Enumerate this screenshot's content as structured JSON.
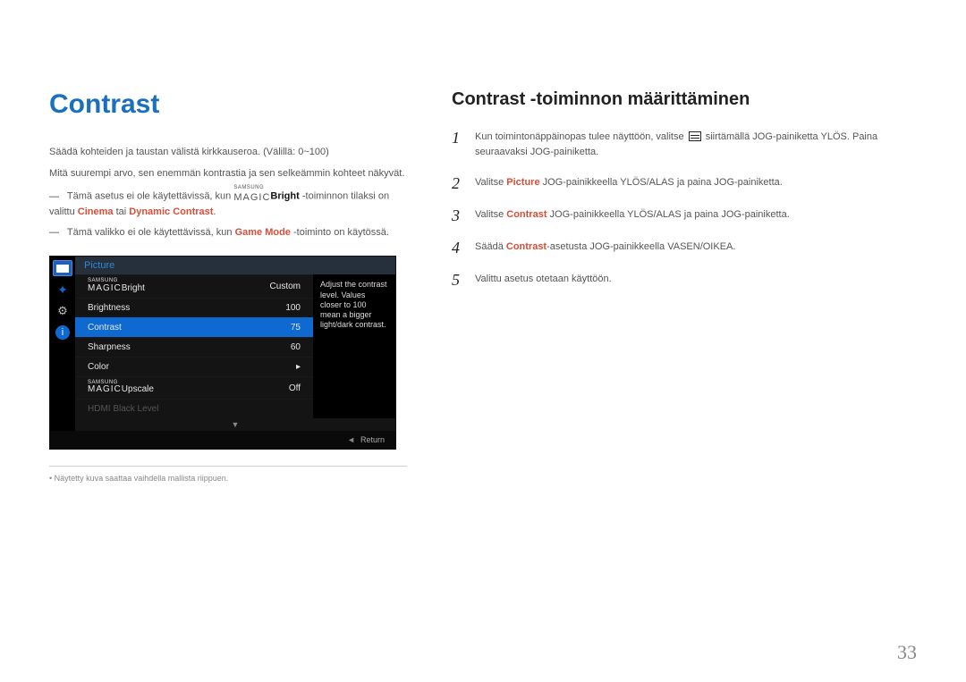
{
  "page_number": "33",
  "left": {
    "title": "Contrast",
    "p1": "Säädä kohteiden ja taustan välistä kirkkauseroa. (Välillä: 0~100)",
    "p2": "Mitä suurempi arvo, sen enemmän kontrastia ja sen selkeämmin kohteet näkyvät.",
    "note1_a": "Tämä asetus ei ole käytettävissä, kun ",
    "note1_magic_sup": "SAMSUNG",
    "note1_magic": "MAGIC",
    "note1_bright": "Bright",
    "note1_b": " -toiminnon tilaksi on valittu ",
    "note1_c1": "Cinema",
    "note1_c_mid": " tai ",
    "note1_c2": "Dynamic Contrast",
    "note1_end": ".",
    "note2_a": "Tämä valikko ei ole käytettävissä, kun ",
    "note2_gm": "Game Mode",
    "note2_b": " -toiminto on käytössä.",
    "footnote": "Näytetty kuva saattaa vaihdella mallista riippuen."
  },
  "osd": {
    "header": "Picture",
    "help": "Adjust the contrast level. Values closer to 100 mean a bigger light/dark contrast.",
    "rows": [
      {
        "label_sup": "SAMSUNG",
        "label": "MAGIC",
        "suffix": "Bright",
        "value": "Custom"
      },
      {
        "label": "Brightness",
        "value": "100"
      },
      {
        "label": "Contrast",
        "value": "75",
        "selected": true
      },
      {
        "label": "Sharpness",
        "value": "60"
      },
      {
        "label": "Color",
        "value": "▸"
      },
      {
        "label_sup": "SAMSUNG",
        "label": "MAGIC",
        "suffix": "Upscale",
        "value": "Off"
      },
      {
        "label": "HDMI Black Level",
        "value": "",
        "disabled": true
      }
    ],
    "down": "▼",
    "return": "Return"
  },
  "right": {
    "title": "Contrast -toiminnon määrittäminen",
    "steps": [
      {
        "n": "1",
        "a": "Kun toimintonäppäinopas tulee näyttöön, valitse ",
        "b": " siirtämällä JOG-painiketta YLÖS. Paina seuraavaksi JOG-painiketta."
      },
      {
        "n": "2",
        "a": "Valitse ",
        "hl": "Picture",
        "b": " JOG-painikkeella YLÖS/ALAS ja paina JOG-painiketta."
      },
      {
        "n": "3",
        "a": "Valitse ",
        "hl": "Contrast",
        "b": " JOG-painikkeella YLÖS/ALAS ja paina JOG-painiketta."
      },
      {
        "n": "4",
        "a": "Säädä ",
        "hl": "Contrast",
        "b": "-asetusta JOG-painikkeella VASEN/OIKEA."
      },
      {
        "n": "5",
        "a": "Valittu asetus otetaan käyttöön."
      }
    ]
  }
}
